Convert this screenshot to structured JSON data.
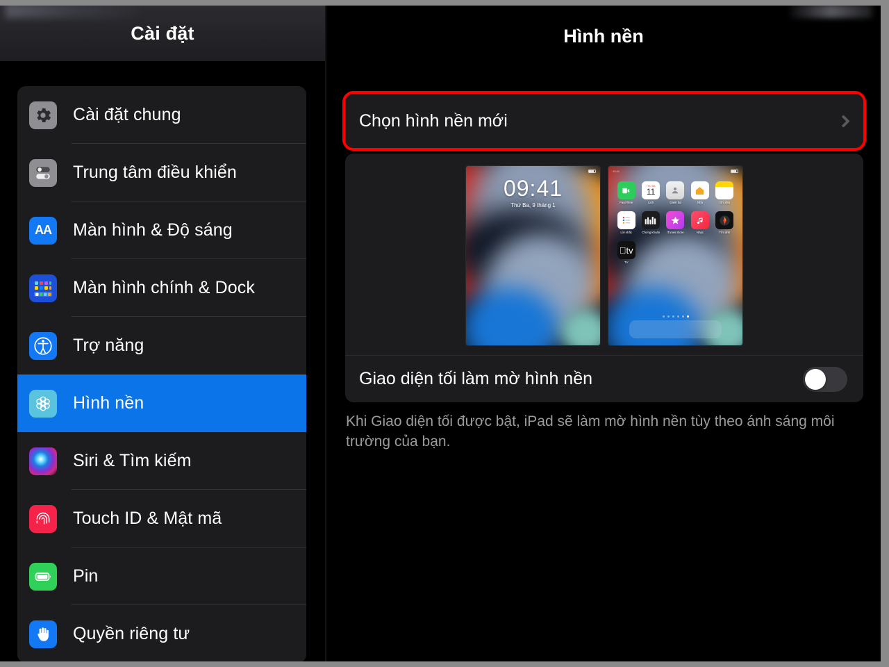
{
  "sidebar": {
    "title": "Cài đặt",
    "items": [
      {
        "label": "Cài đặt chung",
        "icon": "gear-icon",
        "selected": false
      },
      {
        "label": "Trung tâm điều khiển",
        "icon": "control-center-icon",
        "selected": false
      },
      {
        "label": "Màn hình & Độ sáng",
        "icon": "display-brightness-icon",
        "selected": false
      },
      {
        "label": "Màn hình chính & Dock",
        "icon": "home-screen-dock-icon",
        "selected": false
      },
      {
        "label": "Trợ năng",
        "icon": "accessibility-icon",
        "selected": false
      },
      {
        "label": "Hình nền",
        "icon": "wallpaper-icon",
        "selected": true
      },
      {
        "label": "Siri & Tìm kiếm",
        "icon": "siri-icon",
        "selected": false
      },
      {
        "label": "Touch ID & Mật mã",
        "icon": "touch-id-icon",
        "selected": false
      },
      {
        "label": "Pin",
        "icon": "battery-icon",
        "selected": false
      },
      {
        "label": "Quyền riêng tư",
        "icon": "privacy-hand-icon",
        "selected": false
      }
    ]
  },
  "detail": {
    "title": "Hình nền",
    "choose_wallpaper": {
      "label": "Chọn hình nền mới",
      "chevron": "chevron-right-icon",
      "highlighted": true,
      "highlight_color": "#ff0000"
    },
    "preview": {
      "lock_screen": {
        "time": "09:41",
        "date": "Thứ Ba, 9 tháng 1"
      },
      "home_screen": {
        "apps": [
          {
            "name": "FaceTime",
            "glyph": "videocam-icon"
          },
          {
            "name": "Lịch",
            "glyph": "calendar-icon",
            "day": "11",
            "month": "THỨ BA"
          },
          {
            "name": "Danh bạ",
            "glyph": "contacts-icon"
          },
          {
            "name": "Nhà",
            "glyph": "home-icon"
          },
          {
            "name": "Ghi chú",
            "glyph": "notes-icon"
          },
          {
            "name": "Lời nhắc",
            "glyph": "reminders-icon"
          },
          {
            "name": "Chứng khoán",
            "glyph": "stocks-icon"
          },
          {
            "name": "iTunes Store",
            "glyph": "itunes-star-icon"
          },
          {
            "name": "Nhạc",
            "glyph": "music-note-icon"
          },
          {
            "name": "Tìm ảnh",
            "glyph": "find-my-icon"
          },
          {
            "name": "TV",
            "glyph": "apple-tv-icon"
          }
        ],
        "page_dots": 6,
        "active_dot": 6
      }
    },
    "dim_wallpaper": {
      "label": "Giao diện tối làm mờ hình nền",
      "enabled": false
    },
    "dim_description": "Khi Giao diện tối được bật, iPad sẽ làm mờ hình nền tùy theo ánh sáng môi trường của bạn."
  },
  "colors": {
    "selection_blue": "#0a74e8",
    "card_background": "#1c1c1e",
    "highlight_red": "#ff0000"
  }
}
